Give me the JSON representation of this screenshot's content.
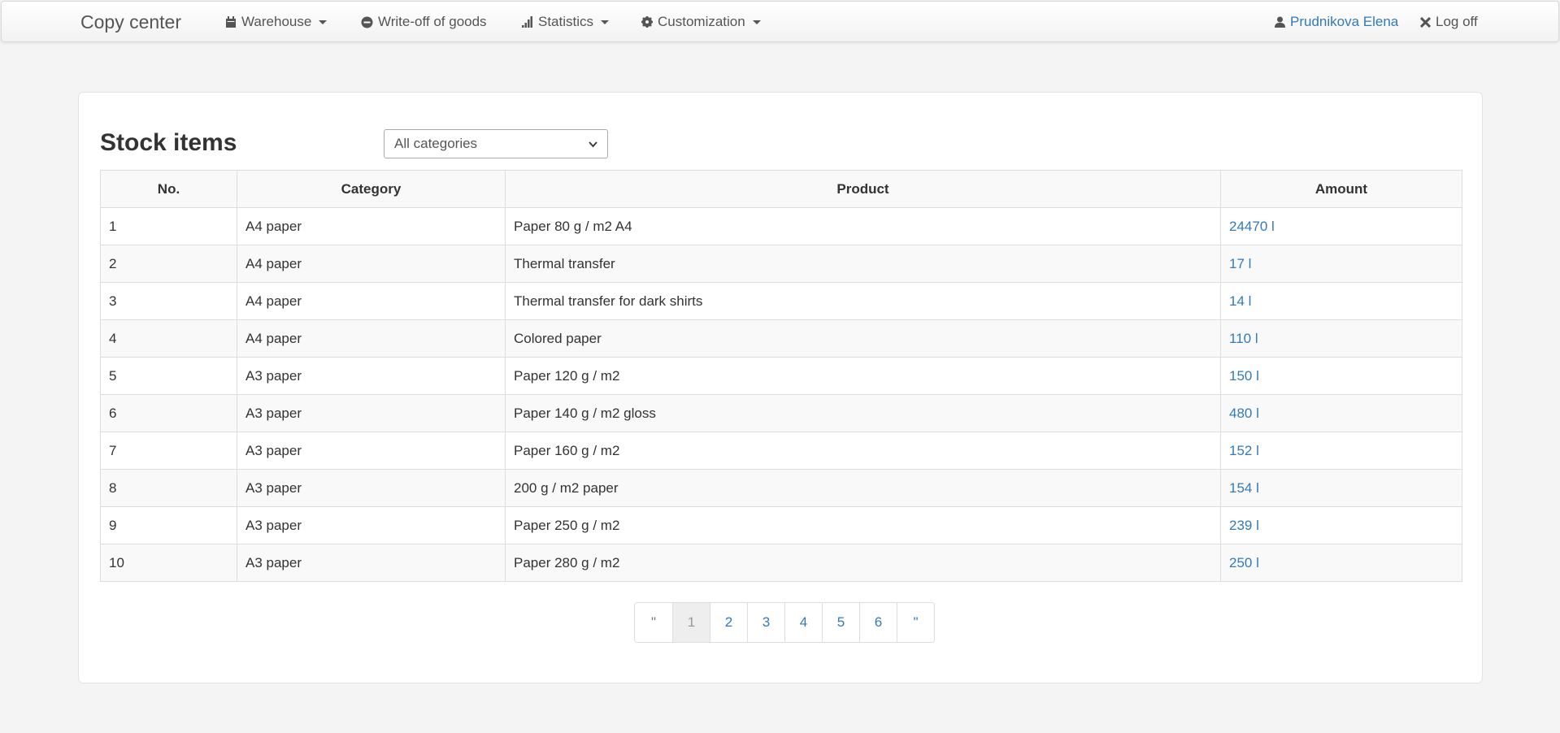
{
  "navbar": {
    "brand": "Copy center",
    "items": [
      {
        "label": "Warehouse",
        "icon": "calendar-icon",
        "dropdown": true
      },
      {
        "label": "Write-off of goods",
        "icon": "minus-circle-icon",
        "dropdown": false
      },
      {
        "label": "Statistics",
        "icon": "signal-bars-icon",
        "dropdown": true
      },
      {
        "label": "Customization",
        "icon": "gear-icon",
        "dropdown": true
      }
    ],
    "user": "Prudnikova Elena",
    "logoff": "Log off"
  },
  "main": {
    "title": "Stock items",
    "category_select": "All categories",
    "table": {
      "headers": [
        "No.",
        "Category",
        "Product",
        "Amount"
      ],
      "rows": [
        [
          "1",
          "A4 paper",
          "Paper 80 g / m2 A4",
          "24470 l"
        ],
        [
          "2",
          "A4 paper",
          "Thermal transfer",
          "17 l"
        ],
        [
          "3",
          "A4 paper",
          "Thermal transfer for dark shirts",
          "14 l"
        ],
        [
          "4",
          "A4 paper",
          "Colored paper",
          "110 l"
        ],
        [
          "5",
          "A3 paper",
          "Paper 120 g / m2",
          "150 l"
        ],
        [
          "6",
          "A3 paper",
          "Paper 140 g / m2 gloss",
          "480 l"
        ],
        [
          "7",
          "A3 paper",
          "Paper 160 g / m2",
          "152 l"
        ],
        [
          "8",
          "A3 paper",
          "200 g / m2 paper",
          "154 l"
        ],
        [
          "9",
          "A3 paper",
          "Paper 250 g / m2",
          "239 l"
        ],
        [
          "10",
          "A3 paper",
          "Paper 280 g / m2",
          "250 l"
        ]
      ]
    },
    "pagination": {
      "prev": "\"",
      "pages": [
        "1",
        "2",
        "3",
        "4",
        "5",
        "6"
      ],
      "next": "\"",
      "active_page": "1"
    }
  },
  "colors": {
    "link": "#337ab7",
    "text": "#333333",
    "background": "#f4f4f4"
  }
}
